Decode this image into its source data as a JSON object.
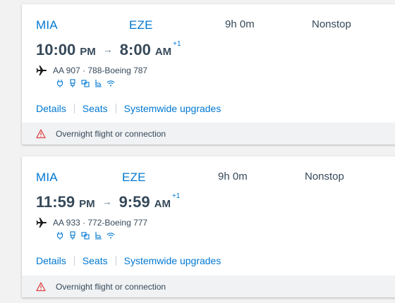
{
  "flights": [
    {
      "origin": "MIA",
      "destination": "EZE",
      "depart_time": "10:00",
      "depart_ampm": "PM",
      "arrive_time": "8:00",
      "arrive_ampm": "AM",
      "day_offset": "+1",
      "duration": "9h 0m",
      "stops": "Nonstop",
      "flight_info": "AA 907 · 788-Boeing 787",
      "links": {
        "details": "Details",
        "seats": "Seats",
        "upgrades": "Systemwide upgrades"
      },
      "notice": "Overnight flight or connection"
    },
    {
      "origin": "MIA",
      "destination": "EZE",
      "depart_time": "11:59",
      "depart_ampm": "PM",
      "arrive_time": "9:59",
      "arrive_ampm": "AM",
      "day_offset": "+1",
      "duration": "9h 0m",
      "stops": "Nonstop",
      "flight_info": "AA 933 · 772-Boeing 777",
      "links": {
        "details": "Details",
        "seats": "Seats",
        "upgrades": "Systemwide upgrades"
      },
      "notice": "Overnight flight or connection"
    }
  ],
  "amenity_icons": [
    "power-outlet-icon",
    "usb-icon",
    "entertainment-icon",
    "seat-icon",
    "wifi-icon"
  ],
  "colors": {
    "link": "#0078d2",
    "text": "#36495a",
    "warning": "#e04444",
    "notice_bg": "#f0f2f4"
  }
}
